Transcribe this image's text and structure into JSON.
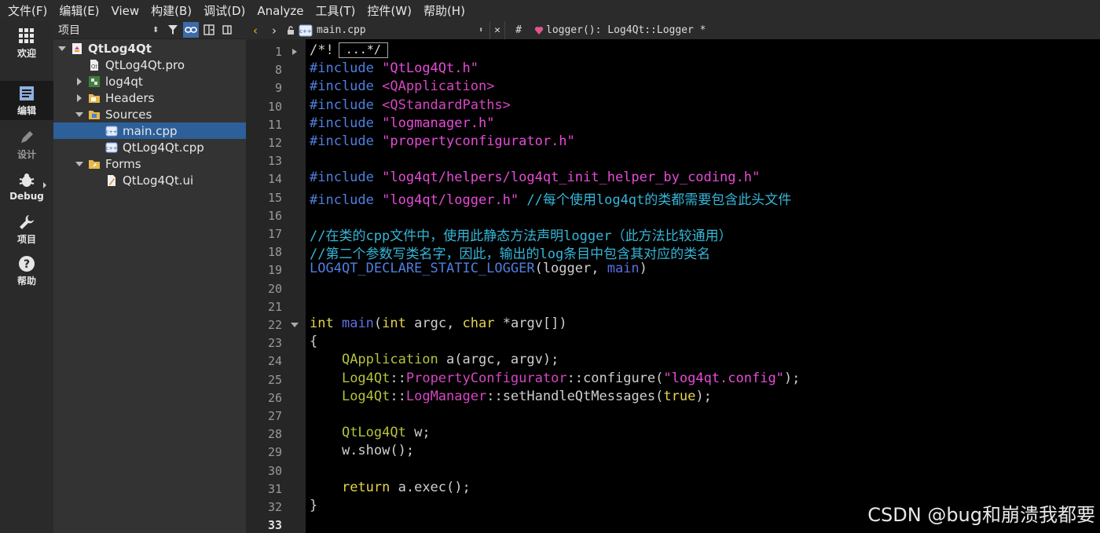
{
  "menu": [
    "文件(F)",
    "编辑(E)",
    "View",
    "构建(B)",
    "调试(D)",
    "Analyze",
    "工具(T)",
    "控件(W)",
    "帮助(H)"
  ],
  "modes": [
    {
      "label": "欢迎",
      "icon": "grid-icon"
    },
    {
      "label": "编辑",
      "icon": "edit-doc-icon"
    },
    {
      "label": "设计",
      "icon": "pencil-icon"
    },
    {
      "label": "Debug",
      "icon": "bug-icon"
    },
    {
      "label": "项目",
      "icon": "wrench-icon"
    },
    {
      "label": "帮助",
      "icon": "help-icon"
    }
  ],
  "project": {
    "pane_title": "项目",
    "tree": [
      {
        "label": "QtLog4Qt",
        "depth": 0,
        "expanded": true,
        "icon": "project-icon",
        "bold": true
      },
      {
        "label": "QtLog4Qt.pro",
        "depth": 1,
        "icon": "pro-file-icon"
      },
      {
        "label": "log4qt",
        "depth": 1,
        "collapsed": true,
        "icon": "subproject-icon"
      },
      {
        "label": "Headers",
        "depth": 1,
        "collapsed": true,
        "icon": "headers-folder-icon"
      },
      {
        "label": "Sources",
        "depth": 1,
        "expanded": true,
        "icon": "sources-folder-icon"
      },
      {
        "label": "main.cpp",
        "depth": 2,
        "icon": "cpp-file-icon",
        "selected": true
      },
      {
        "label": "QtLog4Qt.cpp",
        "depth": 2,
        "icon": "cpp-file-icon"
      },
      {
        "label": "Forms",
        "depth": 1,
        "expanded": true,
        "icon": "forms-folder-icon"
      },
      {
        "label": "QtLog4Qt.ui",
        "depth": 2,
        "icon": "ui-file-icon"
      }
    ]
  },
  "editor": {
    "file_name": "main.cpp",
    "symbol_hash": "#",
    "symbol": "logger(): Log4Qt::Logger *",
    "line_numbers": [
      "1",
      "8",
      "9",
      "10",
      "11",
      "12",
      "13",
      "14",
      "15",
      "16",
      "17",
      "18",
      "19",
      "20",
      "21",
      "22",
      "23",
      "24",
      "25",
      "26",
      "27",
      "28",
      "29",
      "30",
      "31",
      "32",
      "33"
    ],
    "folded_text": "...*/"
  },
  "code_lines": [
    [
      {
        "c": "fn",
        "t": "/*!"
      }
    ],
    [
      {
        "c": "pp",
        "t": "#include"
      },
      {
        "c": "fn",
        "t": " "
      },
      {
        "c": "str",
        "t": "\"QtLog4Qt.h\""
      }
    ],
    [
      {
        "c": "pp",
        "t": "#include"
      },
      {
        "c": "fn",
        "t": " "
      },
      {
        "c": "sys",
        "t": "<QApplication>"
      }
    ],
    [
      {
        "c": "pp",
        "t": "#include"
      },
      {
        "c": "fn",
        "t": " "
      },
      {
        "c": "sys",
        "t": "<QStandardPaths>"
      }
    ],
    [
      {
        "c": "pp",
        "t": "#include"
      },
      {
        "c": "fn",
        "t": " "
      },
      {
        "c": "str",
        "t": "\"logmanager.h\""
      }
    ],
    [
      {
        "c": "pp",
        "t": "#include"
      },
      {
        "c": "fn",
        "t": " "
      },
      {
        "c": "str",
        "t": "\"propertyconfigurator.h\""
      }
    ],
    [],
    [
      {
        "c": "pp",
        "t": "#include"
      },
      {
        "c": "fn",
        "t": " "
      },
      {
        "c": "str",
        "t": "\"log4qt/helpers/log4qt_init_helper_by_coding.h\""
      }
    ],
    [
      {
        "c": "pp",
        "t": "#include"
      },
      {
        "c": "fn",
        "t": " "
      },
      {
        "c": "str",
        "t": "\"log4qt/logger.h\""
      },
      {
        "c": "fn",
        "t": " "
      },
      {
        "c": "cm",
        "t": "//每个使用log4qt的类都需要包含此头文件"
      }
    ],
    [],
    [
      {
        "c": "cm",
        "t": "//在类的cpp文件中，使用此静态方法声明logger（此方法比较通用）"
      }
    ],
    [
      {
        "c": "cm",
        "t": "//第二个参数写类名字，因此，输出的log条目中包含其对应的类名"
      }
    ],
    [
      {
        "c": "mac",
        "t": "LOG4QT_DECLARE_STATIC_LOGGER"
      },
      {
        "c": "fn",
        "t": "(logger, "
      },
      {
        "c": "nm",
        "t": "main"
      },
      {
        "c": "fn",
        "t": ")"
      }
    ],
    [],
    [],
    [
      {
        "c": "kw",
        "t": "int"
      },
      {
        "c": "fn",
        "t": " "
      },
      {
        "c": "nm",
        "t": "main"
      },
      {
        "c": "fn",
        "t": "("
      },
      {
        "c": "kw",
        "t": "int"
      },
      {
        "c": "fn",
        "t": " argc, "
      },
      {
        "c": "kw",
        "t": "char"
      },
      {
        "c": "fn",
        "t": " *argv[])"
      }
    ],
    [
      {
        "c": "fn",
        "t": "{"
      }
    ],
    [
      {
        "c": "fn",
        "t": "    "
      },
      {
        "c": "tyg",
        "t": "QApplication"
      },
      {
        "c": "fn",
        "t": " a(argc, argv);"
      }
    ],
    [
      {
        "c": "fn",
        "t": "    "
      },
      {
        "c": "tyg",
        "t": "Log4Qt"
      },
      {
        "c": "fn",
        "t": "::"
      },
      {
        "c": "sys",
        "t": "PropertyConfigurator"
      },
      {
        "c": "fn",
        "t": "::configure("
      },
      {
        "c": "str",
        "t": "\"log4qt.config\""
      },
      {
        "c": "fn",
        "t": ");"
      }
    ],
    [
      {
        "c": "fn",
        "t": "    "
      },
      {
        "c": "tyg",
        "t": "Log4Qt"
      },
      {
        "c": "fn",
        "t": "::"
      },
      {
        "c": "sys",
        "t": "LogManager"
      },
      {
        "c": "fn",
        "t": "::setHandleQtMessages("
      },
      {
        "c": "kw",
        "t": "true"
      },
      {
        "c": "fn",
        "t": ");"
      }
    ],
    [],
    [
      {
        "c": "fn",
        "t": "    "
      },
      {
        "c": "tyg",
        "t": "QtLog4Qt"
      },
      {
        "c": "fn",
        "t": " w;"
      }
    ],
    [
      {
        "c": "fn",
        "t": "    w.show();"
      }
    ],
    [],
    [
      {
        "c": "fn",
        "t": "    "
      },
      {
        "c": "kw",
        "t": "return"
      },
      {
        "c": "fn",
        "t": " a.exec();"
      }
    ],
    [
      {
        "c": "fn",
        "t": "}"
      }
    ],
    []
  ],
  "watermark": "CSDN @bug和崩溃我都要"
}
